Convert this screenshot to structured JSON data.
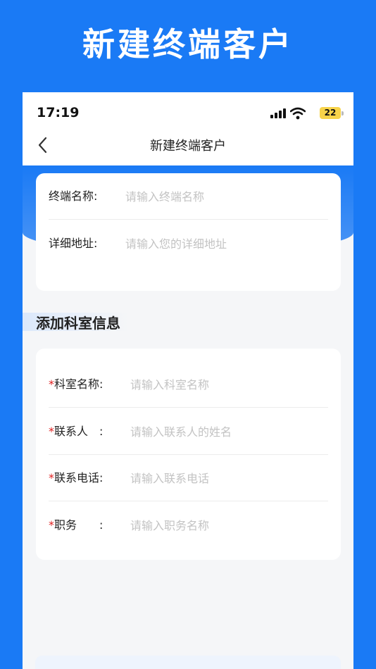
{
  "promo": {
    "title": "新建终端客户"
  },
  "status_bar": {
    "time": "17:19",
    "battery": "22"
  },
  "nav": {
    "title": "新建终端客户"
  },
  "terminal_card": {
    "name_label": "终端名称:",
    "name_placeholder": "请输入终端名称",
    "address_label": "详细地址:",
    "address_placeholder": "请输入您的详细地址"
  },
  "department_section": {
    "title": "添加科室信息",
    "required_mark": "*",
    "fields": [
      {
        "label": "科室名称:",
        "placeholder": "请输入科室名称"
      },
      {
        "label": "联系人　:",
        "placeholder": "请输入联系人的姓名"
      },
      {
        "label": "联系电话:",
        "placeholder": "请输入联系电话"
      },
      {
        "label": "职务　　:",
        "placeholder": "请输入职务名称"
      }
    ]
  },
  "colors": {
    "brand_blue": "#1a7af5",
    "required_red": "#e02020",
    "placeholder_gray": "#c3c3c3"
  }
}
